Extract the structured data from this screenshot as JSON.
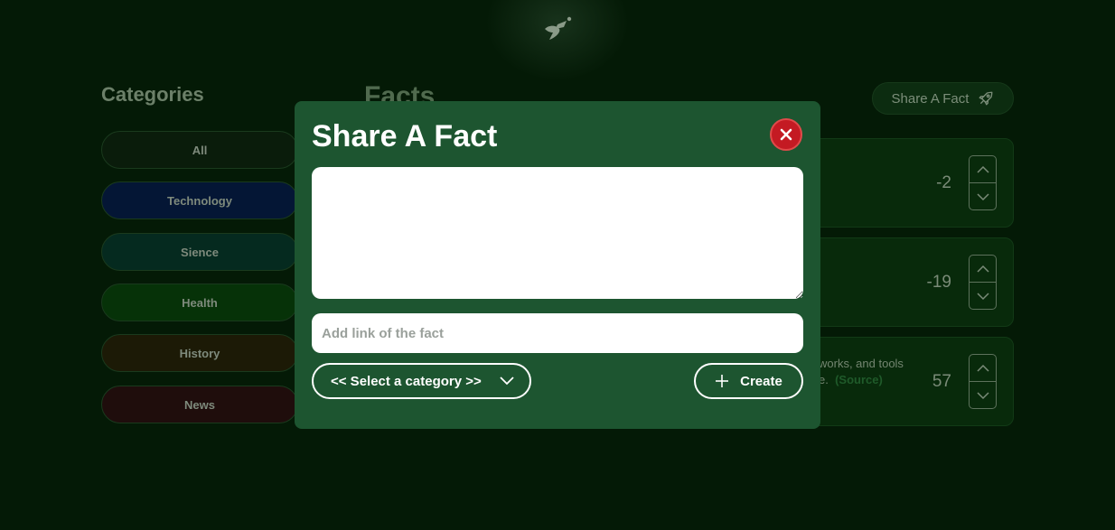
{
  "categories": {
    "title": "Categories",
    "items": [
      {
        "label": "All",
        "bg": "#0a1c0b"
      },
      {
        "label": "Technology",
        "bg": "#041635"
      },
      {
        "label": "Sience",
        "bg": "#052a1f"
      },
      {
        "label": "Health",
        "bg": "#063208"
      },
      {
        "label": "History",
        "bg": "#1c1a06"
      },
      {
        "label": "News",
        "bg": "#1f0d0c"
      }
    ]
  },
  "facts": {
    "title": "Facts",
    "share_button_label": "Share A Fact",
    "cards": [
      {
        "text": "",
        "source": "",
        "votes": "-2"
      },
      {
        "text": "",
        "source": "",
        "votes": "-19"
      },
      {
        "text": "works, and tools",
        "text2": "e.",
        "source": "(Source)",
        "votes": "57"
      }
    ]
  },
  "modal": {
    "title": "Share A Fact",
    "fact_text_value": "",
    "link_placeholder": "Add link of the fact",
    "category_select_label": "<< Select a category >>",
    "create_label": "Create"
  },
  "icons": {
    "logo": "logo-icon",
    "rocket": "rocket-icon",
    "close": "close-icon",
    "chevron_down": "chevron-down-icon",
    "plus": "plus-icon"
  },
  "colors": {
    "background": "#041a06",
    "modal_bg": "#1d5530",
    "close_red": "#c41a23"
  }
}
